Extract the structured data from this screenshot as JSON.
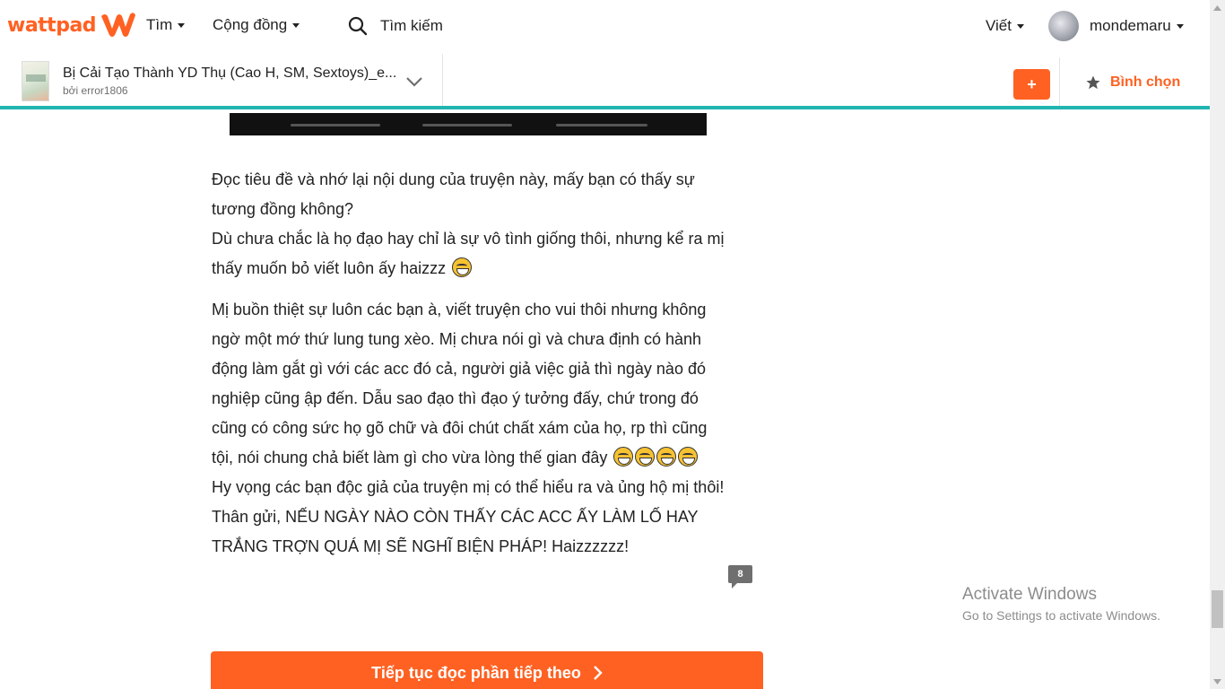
{
  "colors": {
    "brand": "#ff6122",
    "accent_teal": "#20b5b0",
    "text": "#222222",
    "muted": "#6f6f6f"
  },
  "nav": {
    "logo_text": "wattpad",
    "find_label": "Tìm",
    "community_label": "Cộng đồng",
    "search_label": "Tìm kiếm",
    "write_label": "Viết",
    "username": "mondemaru"
  },
  "story": {
    "title": "Bị Cải Tạo Thành YD Thụ (Cao H, SM, Sextoys)_e...",
    "author": "bởi error1806",
    "add_label": "+",
    "vote_label": "Bình chọn"
  },
  "content": {
    "p1_a": "Đọc tiêu đề và nhớ lại nội dung của truyện này, mấy bạn có thấy sự tương đồng không?",
    "p1_b": "Dù chưa chắc là họ đạo hay chỉ là sự vô tình giống thôi, nhưng kể ra mị thấy muốn bỏ viết luôn ấy haizzz",
    "p2_a": "Mị buồn thiệt sự luôn các bạn à, viết truyện cho vui thôi nhưng không ngờ một mớ thứ lung tung xèo. Mị chưa nói gì và chưa định có hành động làm gắt gì với các acc đó cả, người giả việc giả thì ngày nào đó nghiệp cũng ập đến. Dẫu sao đạo thì đạo ý tưởng đấy, chứ trong đó cũng có công sức họ gõ chữ và đôi chút chất xám của họ, rp thì cũng tội, nói chung chả biết làm gì cho vừa lòng thế gian đây",
    "p2_b": "Hy vọng các bạn độc giả của truyện mị có thể hiểu ra và ủng hộ mị thôi!",
    "p2_c": "Thân gửi, NẾU NGÀY NÀO CÒN THẤY CÁC ACC ẤY LÀM LỐ HAY TRẮNG TRỢN QUÁ MỊ SẼ NGHĨ BIỆN PHÁP! Haizzzzzz!",
    "comment_count": "8",
    "continue_label": "Tiếp tục đọc phần tiếp theo"
  },
  "watermark": {
    "title": "Activate Windows",
    "subtitle": "Go to Settings to activate Windows."
  },
  "icons": [
    "wattpad-w-icon",
    "search-icon",
    "chevron-down-icon",
    "star-icon",
    "chevron-right-icon",
    "laughing-emoji-icon",
    "comment-icon"
  ]
}
